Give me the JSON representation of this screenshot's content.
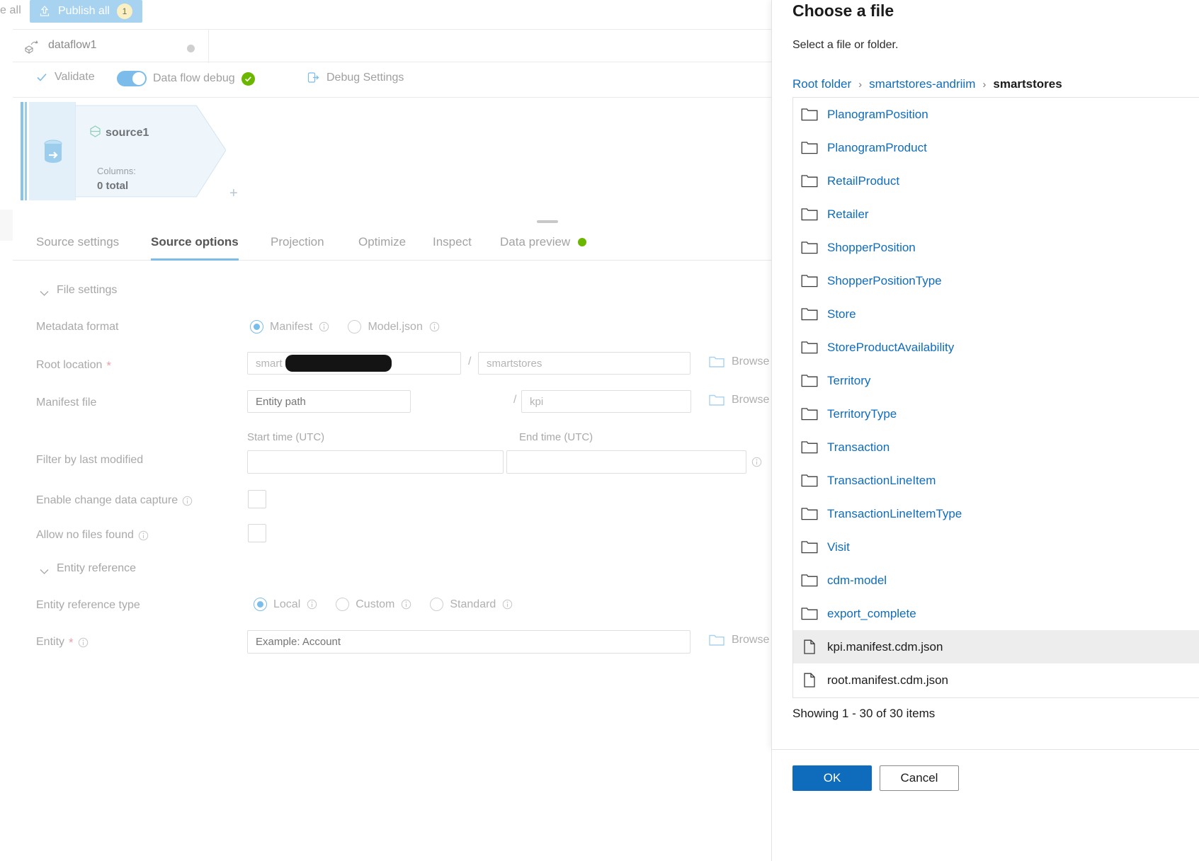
{
  "topbar": {
    "truncated_label": "e all",
    "publish_all_label": "Publish all",
    "publish_all_badge": "1",
    "publish_icon": "upload-icon"
  },
  "dataflow": {
    "name": "dataflow1",
    "icon": "dataflow-icon",
    "status_dot": "unsaved-dot"
  },
  "toolbar": {
    "validate_label": "Validate",
    "validate_icon": "checkmark-icon",
    "debug_toggle_label": "Data flow debug",
    "debug_toggle_on": true,
    "debug_status_icon": "green-check-icon",
    "debug_settings_label": "Debug Settings",
    "debug_settings_icon": "debug-settings-icon"
  },
  "canvas": {
    "node": {
      "name": "source1",
      "icon": "source-database-icon",
      "columns_label": "Columns:",
      "columns_value": "0 total",
      "add_label": "+"
    }
  },
  "tabs": [
    {
      "label": "Source settings",
      "active": false
    },
    {
      "label": "Source options",
      "active": true
    },
    {
      "label": "Projection",
      "active": false
    },
    {
      "label": "Optimize",
      "active": false
    },
    {
      "label": "Inspect",
      "active": false
    },
    {
      "label": "Data preview",
      "active": false,
      "status_dot": "green"
    }
  ],
  "form": {
    "file_settings_title": "File settings",
    "entity_reference_title": "Entity reference",
    "metadata_format": {
      "label": "Metadata format",
      "options": [
        {
          "label": "Manifest",
          "selected": true
        },
        {
          "label": "Model.json",
          "selected": false
        }
      ]
    },
    "root_location": {
      "label": "Root location",
      "required": true,
      "value_prefix": "smart",
      "value_redacted": true,
      "second_value": "smartstores",
      "separator": "/",
      "browse_label": "Browse"
    },
    "manifest_file": {
      "label": "Manifest file",
      "placeholder": "Entity path",
      "second_value": "kpi",
      "separator": "/",
      "browse_label": "Browse"
    },
    "filter_last_modified": {
      "label": "Filter by last modified",
      "start_label": "Start time (UTC)",
      "end_label": "End time (UTC)",
      "start_value": "",
      "end_value": ""
    },
    "enable_cdc": {
      "label": "Enable change data capture",
      "checked": false
    },
    "allow_no_files": {
      "label": "Allow no files found",
      "checked": false
    },
    "entity_reference_type": {
      "label": "Entity reference type",
      "options": [
        {
          "label": "Local",
          "selected": true
        },
        {
          "label": "Custom",
          "selected": false
        },
        {
          "label": "Standard",
          "selected": false
        }
      ]
    },
    "entity": {
      "label": "Entity",
      "required": true,
      "placeholder": "Example: Account",
      "browse_label": "Browse"
    }
  },
  "dialog": {
    "title": "Choose a file",
    "subtitle": "Select a file or folder.",
    "breadcrumbs": [
      {
        "label": "Root folder",
        "current": false
      },
      {
        "label": "smartstores-andriim",
        "current": false
      },
      {
        "label": "smartstores",
        "current": true
      }
    ],
    "breadcrumb_separator": "›",
    "items": [
      {
        "name": "PlanogramPosition",
        "type": "folder",
        "selected": false
      },
      {
        "name": "PlanogramProduct",
        "type": "folder",
        "selected": false
      },
      {
        "name": "RetailProduct",
        "type": "folder",
        "selected": false
      },
      {
        "name": "Retailer",
        "type": "folder",
        "selected": false
      },
      {
        "name": "ShopperPosition",
        "type": "folder",
        "selected": false
      },
      {
        "name": "ShopperPositionType",
        "type": "folder",
        "selected": false
      },
      {
        "name": "Store",
        "type": "folder",
        "selected": false
      },
      {
        "name": "StoreProductAvailability",
        "type": "folder",
        "selected": false
      },
      {
        "name": "Territory",
        "type": "folder",
        "selected": false
      },
      {
        "name": "TerritoryType",
        "type": "folder",
        "selected": false
      },
      {
        "name": "Transaction",
        "type": "folder",
        "selected": false
      },
      {
        "name": "TransactionLineItem",
        "type": "folder",
        "selected": false
      },
      {
        "name": "TransactionLineItemType",
        "type": "folder",
        "selected": false
      },
      {
        "name": "Visit",
        "type": "folder",
        "selected": false
      },
      {
        "name": "cdm-model",
        "type": "folder",
        "selected": false
      },
      {
        "name": "export_complete",
        "type": "folder",
        "selected": false
      },
      {
        "name": "kpi.manifest.cdm.json",
        "type": "file",
        "selected": true
      },
      {
        "name": "root.manifest.cdm.json",
        "type": "file",
        "selected": false
      }
    ],
    "showing_text": "Showing 1 - 30 of 30 items",
    "ok_label": "OK",
    "cancel_label": "Cancel"
  },
  "colors": {
    "accent_blue": "#0f6cbd",
    "light_blue": "#7cbcea",
    "publish_bar": "#a7d3f0",
    "green_status": "#6bb700",
    "badge_yellow": "#fbf0c4"
  }
}
